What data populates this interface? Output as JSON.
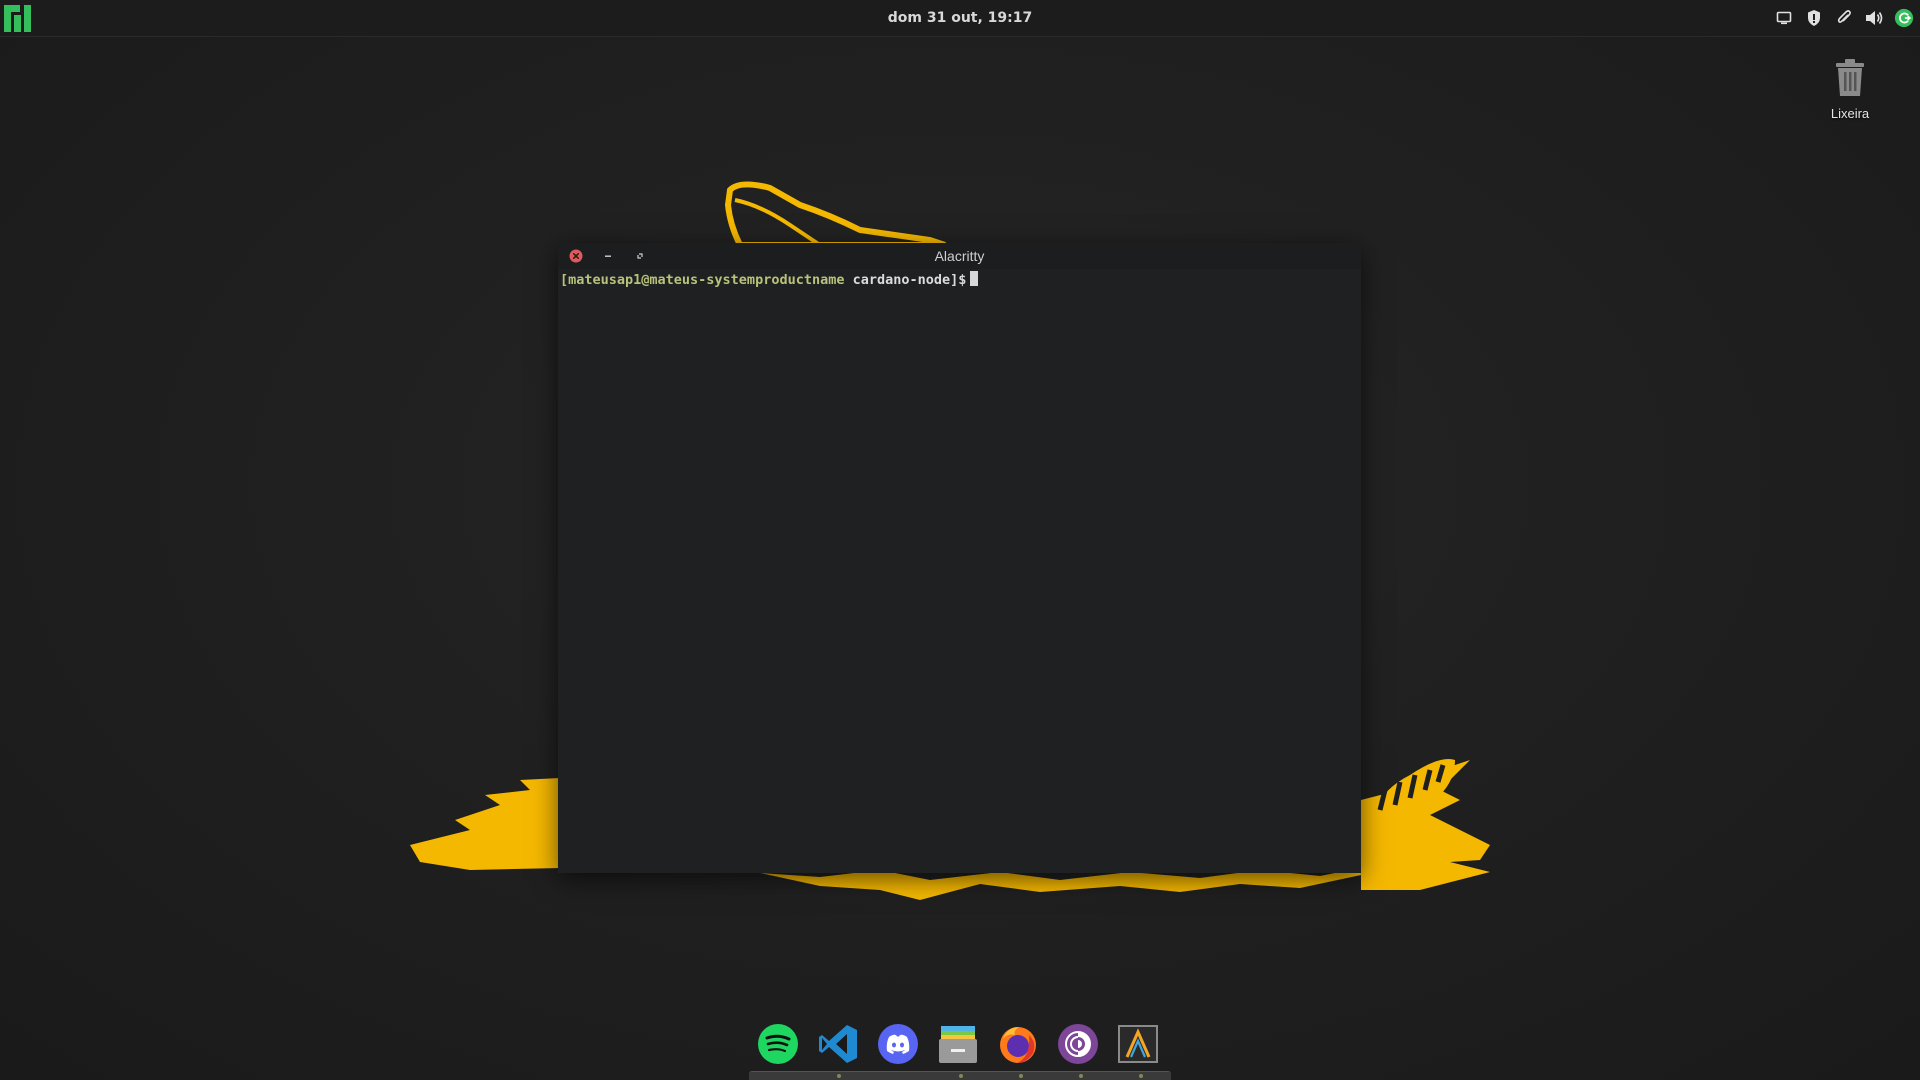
{
  "top_panel": {
    "clock": "dom 31 out, 19:17",
    "tray_icons": [
      "screen-icon",
      "shield-icon",
      "paperclip-icon",
      "volume-icon",
      "update-icon"
    ]
  },
  "desktop": {
    "trash_label": "Lixeira"
  },
  "window": {
    "title": "Alacritty",
    "prompt_user_host": "[mateusap1@mateus-systemproductname",
    "prompt_dir": " cardano-node]$"
  },
  "dock": {
    "items": [
      "spotify-icon",
      "vscode-icon",
      "discord-icon",
      "files-icon",
      "firefox-icon",
      "tor-browser-icon",
      "alacritty-icon"
    ]
  },
  "colors": {
    "accent": "#f5b800",
    "manjaro_green": "#35bf5c",
    "panel_bg": "#1c1c1c",
    "terminal_bg": "#1f2022"
  }
}
